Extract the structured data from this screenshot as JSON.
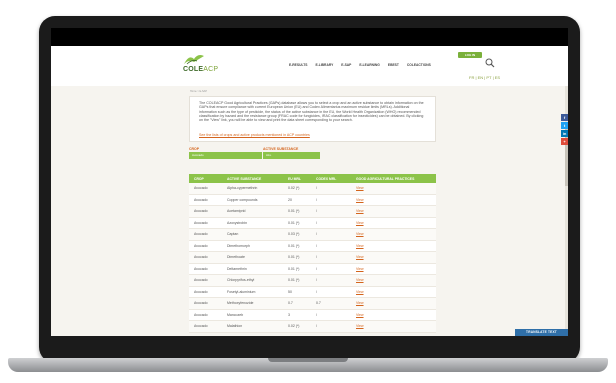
{
  "header": {
    "logo_main": "COLE",
    "logo_sub": "ACP",
    "login_label": "LOG IN",
    "nav": [
      "E-RESULTS",
      "E-LIBRARY",
      "E-SAP",
      "E-LEARNING",
      "EBEST",
      "COLEACTIONS"
    ],
    "languages": "FR | EN | PT | ES"
  },
  "breadcrumb": "Home > E-SAP",
  "intro": {
    "text": "The COLEACP Good Agricultural Practices (GAPs) database allows you to select a crop and an active substance to obtain information on the GAPs that ensure compliance with current European Union (EU) and Codex Alimentarius maximum residue limits (MRLs). Additional information such as the type of pesticide, the status of the active substance in the EU, the World Health Organization (WHO) recommended classification by hazard and the resistance group (FRAC code for fungicides, IRAC classification for insecticides) can be obtained. By clicking on the \"View\" link, you will be able to view and print the data sheet corresponding to your search.",
    "link": "See the lists of crops and active products mentioned in ACP countries"
  },
  "filters": {
    "crop_label": "CROP",
    "crop_value": "Avocado",
    "substance_label": "ACTIVE SUBSTANCE",
    "substance_value": "ALL"
  },
  "table": {
    "headers": [
      "CROP",
      "ACTIVE SUBSTANCE",
      "EU MRL",
      "CODEX MRL",
      "GOOD AGRICULTURAL PRACTICES"
    ],
    "rows": [
      {
        "crop": "Avocado",
        "substance": "Alpha-cypermethrin",
        "eu": "0.02 (*)",
        "codex": "/",
        "gap": "View"
      },
      {
        "crop": "Avocado",
        "substance": "Copper compounds",
        "eu": "20",
        "codex": "/",
        "gap": "View"
      },
      {
        "crop": "Avocado",
        "substance": "Acetamiprid",
        "eu": "0.01 (*)",
        "codex": "/",
        "gap": "View"
      },
      {
        "crop": "Avocado",
        "substance": "Azoxystrobin",
        "eu": "0.01 (*)",
        "codex": "/",
        "gap": "View"
      },
      {
        "crop": "Avocado",
        "substance": "Captan",
        "eu": "0.03 (*)",
        "codex": "/",
        "gap": "View"
      },
      {
        "crop": "Avocado",
        "substance": "Dimethomorph",
        "eu": "0.01 (*)",
        "codex": "/",
        "gap": "View"
      },
      {
        "crop": "Avocado",
        "substance": "Dimethoate",
        "eu": "0.01 (*)",
        "codex": "/",
        "gap": "View"
      },
      {
        "crop": "Avocado",
        "substance": "Deltamethrin",
        "eu": "0.01 (*)",
        "codex": "/",
        "gap": "View"
      },
      {
        "crop": "Avocado",
        "substance": "Chlorpyrifos-ethyl",
        "eu": "0.01 (*)",
        "codex": "/",
        "gap": "View"
      },
      {
        "crop": "Avocado",
        "substance": "Fosetyl-aluminium",
        "eu": "50",
        "codex": "/",
        "gap": "View"
      },
      {
        "crop": "Avocado",
        "substance": "Methoxyfenozide",
        "eu": "0.7",
        "codex": "0.7",
        "gap": "View"
      },
      {
        "crop": "Avocado",
        "substance": "Mancozeb",
        "eu": "3",
        "codex": "/",
        "gap": "View"
      },
      {
        "crop": "Avocado",
        "substance": "Malathion",
        "eu": "0.02 (*)",
        "codex": "/",
        "gap": "View"
      }
    ]
  },
  "social": [
    {
      "icon": "facebook-icon",
      "glyph": "f",
      "color": "#3b5998"
    },
    {
      "icon": "twitter-icon",
      "glyph": "t",
      "color": "#1da1f2"
    },
    {
      "icon": "linkedin-icon",
      "glyph": "in",
      "color": "#0077b5"
    },
    {
      "icon": "plus-icon",
      "glyph": "+",
      "color": "#dd4b39"
    }
  ],
  "translate_label": "TRANSLATE TEXT"
}
